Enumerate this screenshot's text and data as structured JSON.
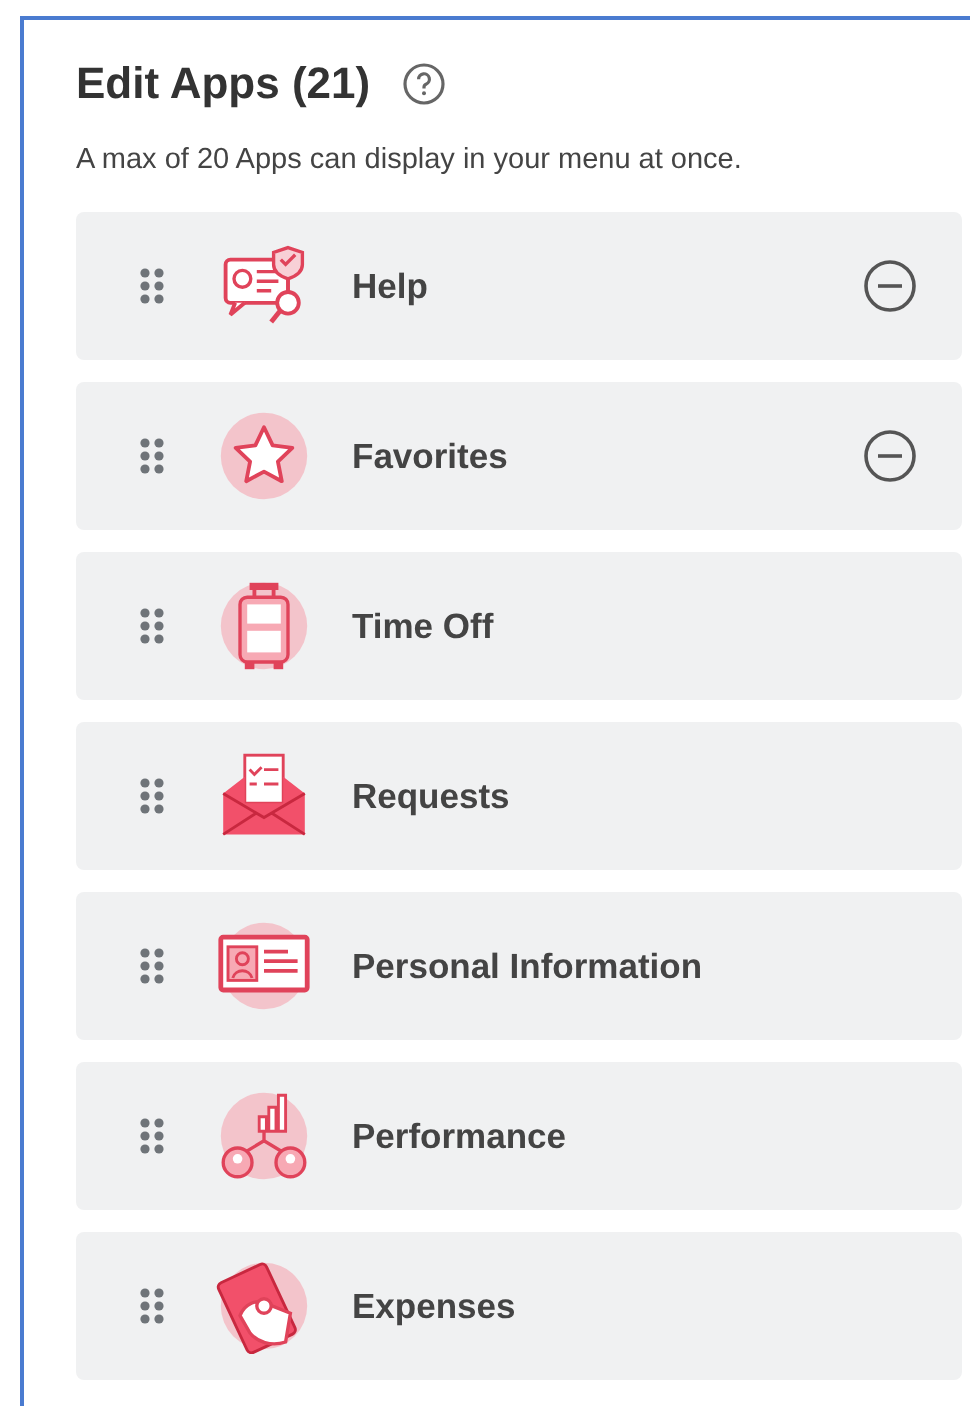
{
  "header": {
    "title": "Edit Apps (21)",
    "subtitle": "A max of 20 Apps can display in your menu at once."
  },
  "apps": [
    {
      "label": "Help",
      "kind": "help",
      "removable": true
    },
    {
      "label": "Favorites",
      "kind": "favorites",
      "removable": true
    },
    {
      "label": "Time Off",
      "kind": "time-off",
      "removable": false
    },
    {
      "label": "Requests",
      "kind": "requests",
      "removable": false
    },
    {
      "label": "Personal Information",
      "kind": "personal",
      "removable": false
    },
    {
      "label": "Performance",
      "kind": "performance",
      "removable": false
    },
    {
      "label": "Expenses",
      "kind": "expenses",
      "removable": false
    }
  ]
}
